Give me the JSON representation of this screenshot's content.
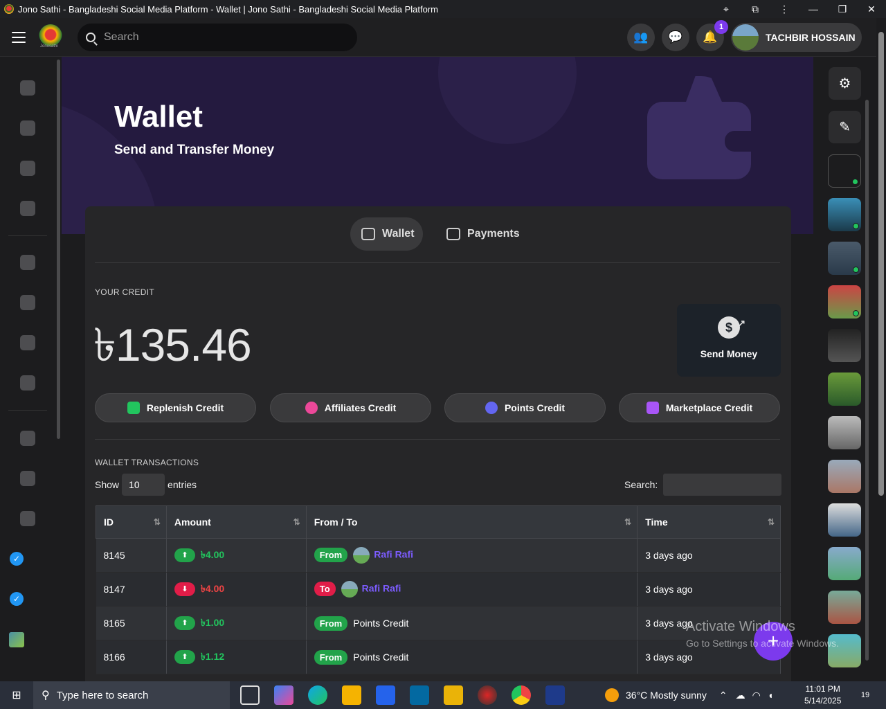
{
  "window": {
    "title": "Jono Sathi - Bangladeshi Social Media Platform - Wallet | Jono Sathi - Bangladeshi Social Media Platform"
  },
  "header": {
    "logo_text": "Jonosathi",
    "search_placeholder": "Search",
    "notifications_count": "1",
    "user_name": "TACHBIR HOSSAIN"
  },
  "hero": {
    "title": "Wallet",
    "subtitle": "Send and Transfer Money"
  },
  "tabs": [
    {
      "label": "Wallet",
      "active": true
    },
    {
      "label": "Payments",
      "active": false
    }
  ],
  "credit": {
    "label": "YOUR CREDIT",
    "amount": "৳135.46",
    "send_label": "Send Money"
  },
  "credit_buttons": [
    {
      "label": "Replenish Credit",
      "color": "#22c55e"
    },
    {
      "label": "Affiliates Credit",
      "color": "#ec4899"
    },
    {
      "label": "Points Credit",
      "color": "#6366f1"
    },
    {
      "label": "Marketplace Credit",
      "color": "#a855f7"
    }
  ],
  "transactions": {
    "label": "WALLET TRANSACTIONS",
    "show_label": "Show",
    "entries_value": "10",
    "entries_label": "entries",
    "search_label": "Search:",
    "columns": [
      "ID",
      "Amount",
      "From / To",
      "Time"
    ],
    "rows": [
      {
        "id": "8145",
        "direction": "in",
        "amount": "৳4.00",
        "tag": "From",
        "party": "Rafi Rafi",
        "party_link": true,
        "time": "3 days ago"
      },
      {
        "id": "8147",
        "direction": "out",
        "amount": "৳4.00",
        "tag": "To",
        "party": "Rafi Rafi",
        "party_link": true,
        "time": "3 days ago"
      },
      {
        "id": "8165",
        "direction": "in",
        "amount": "৳1.00",
        "tag": "From",
        "party": "Points Credit",
        "party_link": false,
        "time": "3 days ago"
      },
      {
        "id": "8166",
        "direction": "in",
        "amount": "৳1.12",
        "tag": "From",
        "party": "Points Credit",
        "party_link": false,
        "time": "3 days ago"
      }
    ]
  },
  "watermark": {
    "line1": "Activate Windows",
    "line2": "Go to Settings to activate Windows."
  },
  "taskbar": {
    "search_placeholder": "Type here to search",
    "weather": "36°C  Mostly sunny",
    "time": "11:01 PM",
    "date": "5/14/2025",
    "notifications": "19"
  },
  "colors": {
    "accent": "#7c3aed",
    "hero_bg": "#241a3f",
    "positive": "#22c55e",
    "negative": "#ef4444"
  }
}
